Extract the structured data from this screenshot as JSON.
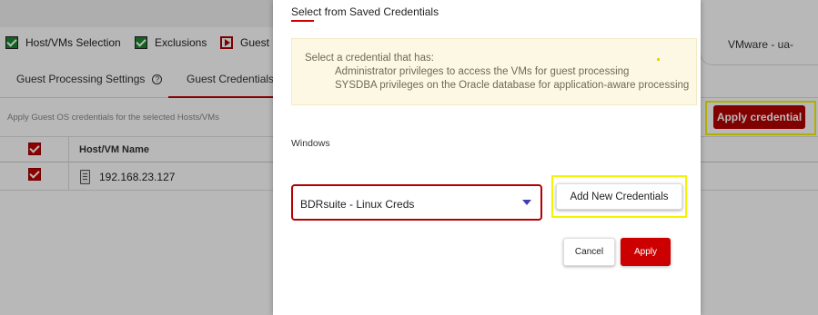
{
  "background": {
    "steps": [
      {
        "label": "Host/VMs Selection",
        "state": "checked"
      },
      {
        "label": "Exclusions",
        "state": "checked"
      },
      {
        "label": "Guest P",
        "state": "current"
      }
    ],
    "vmware_tab": "VMware - ua-",
    "subtabs": [
      {
        "label": "Guest Processing Settings"
      },
      {
        "label": "Guest Credentials"
      }
    ],
    "apply_note": "Apply Guest OS credentials for the selected Hosts/VMs",
    "apply_credential_label": "Apply credential",
    "table": {
      "column_header": "Host/VM Name",
      "rows": [
        {
          "name": "192.168.23.127",
          "checked": true
        }
      ]
    }
  },
  "modal": {
    "title": "Select from Saved Credentials",
    "info_intro": "Select a credential that has:",
    "info_items": [
      "Administrator privileges to access the VMs for guest processing",
      "SYSDBA privileges on the Oracle database for application-aware processing"
    ],
    "section_label": "Windows",
    "selected_credential": "BDRsuite - Linux Creds",
    "add_new_label": "Add New Credentials",
    "cancel_label": "Cancel",
    "apply_label": "Apply"
  },
  "colors": {
    "accent_red": "#c00000",
    "highlight_yellow": "#f4f400",
    "info_bg": "#fdf8e4"
  }
}
